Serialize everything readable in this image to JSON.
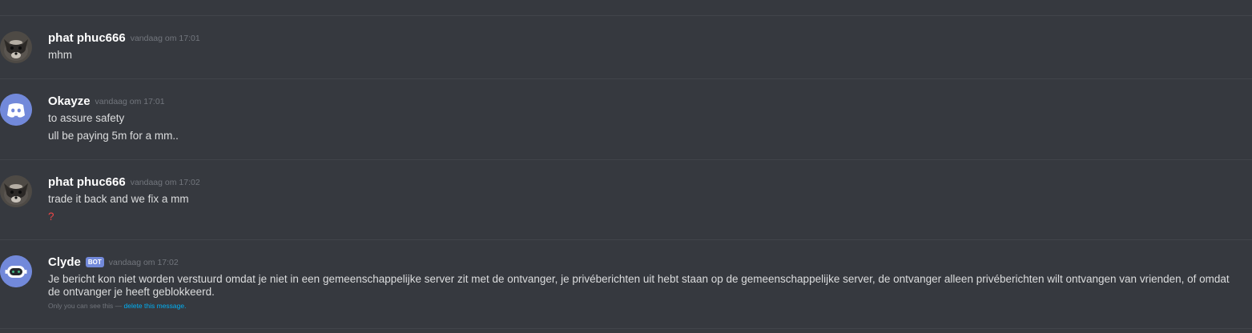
{
  "messages": [
    {
      "author": "phat phuc666",
      "timestamp": "vandaag om 17:01",
      "avatar_icon": "raccoon-avatar-icon",
      "lines": [
        "mhm"
      ]
    },
    {
      "author": "Okayze",
      "timestamp": "vandaag om 17:01",
      "avatar_icon": "discord-default-avatar-icon",
      "avatar_color": "#7289da",
      "lines": [
        "to assure safety",
        "ull be paying 5m for a mm.."
      ]
    },
    {
      "author": "phat phuc666",
      "timestamp": "vandaag om 17:02",
      "avatar_icon": "raccoon-avatar-icon",
      "lines": [
        "trade it back and we fix a mm",
        "?"
      ]
    },
    {
      "author": "Clyde",
      "bot_tag": "BOT",
      "timestamp": "vandaag om 17:02",
      "avatar_icon": "clyde-bot-avatar-icon",
      "avatar_color": "#7289da",
      "lines": [
        "Je bericht kon niet worden verstuurd omdat je niet in een gemeenschappelijke server zit met de ontvanger, je privéberichten uit hebt staan op de gemeenschappelijke server, de ontvanger alleen privéberichten wilt ontvangen van vrienden, of omdat de ontvanger je heeft geblokkeerd."
      ],
      "ephemeral_note": "Only you can see this — ",
      "ephemeral_link": "delete this message."
    }
  ],
  "colors": {
    "background": "#36393f",
    "username": "#ffffff",
    "message_text": "#dcddde",
    "timestamp": "#72767d",
    "mention_red": "#f04747",
    "link": "#00b0f4",
    "blurple": "#7289da"
  }
}
